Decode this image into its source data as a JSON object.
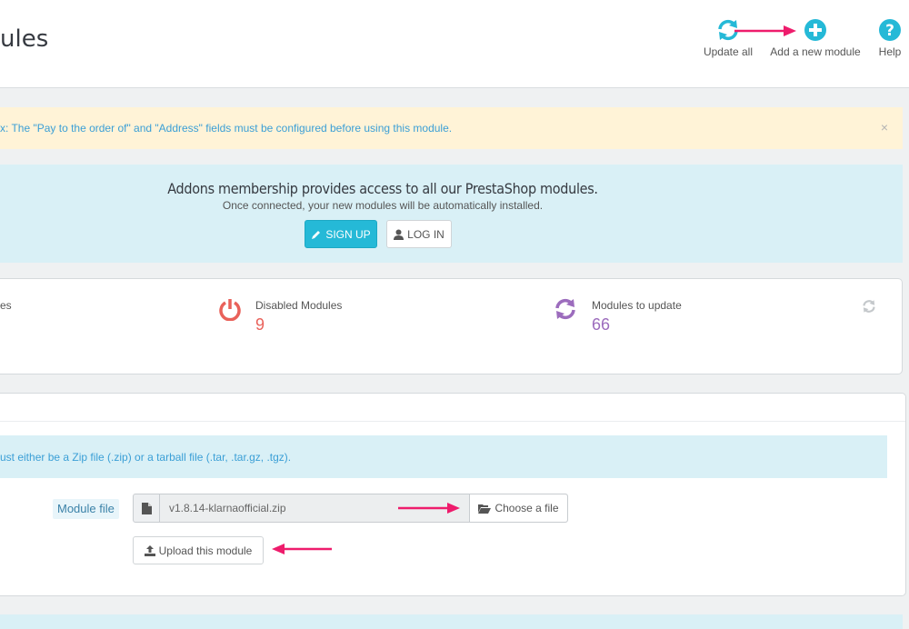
{
  "header": {
    "title": "ules",
    "toolbar": {
      "update_all": "Update all",
      "add_new_module": "Add a new module",
      "help": "Help"
    }
  },
  "warning": {
    "text": "x: The \"Pay to the order of\" and \"Address\" fields must be configured before using this module.",
    "close": "×"
  },
  "addons": {
    "title": "Addons membership provides access to all our PrestaShop modules.",
    "subtitle": "Once connected, your new modules will be automatically installed.",
    "signup": "SIGN UP",
    "login": "LOG IN"
  },
  "stats": {
    "first_label_fragment": "es",
    "disabled_label": "Disabled Modules",
    "disabled_value": "9",
    "update_label": "Modules to update",
    "update_value": "66"
  },
  "upload": {
    "info": "ust either be a Zip file (.zip) or a tarball file (.tar, .tar.gz, .tgz).",
    "file_label": "Module file",
    "file_value": "v1.8.14-klarnaofficial.zip",
    "choose": "Choose a file",
    "upload_button": "Upload this module"
  },
  "colors": {
    "accent": "#25b9d7",
    "warning_bg": "#fff3d7",
    "info_bg": "#d9f0f6",
    "disabled": "#e9615a",
    "update": "#9c6cbd",
    "arrow": "#ee1c6c"
  },
  "icons": [
    "refresh-icon",
    "plus-circle-icon",
    "help-icon",
    "power-icon",
    "file-icon",
    "folder-open-icon",
    "upload-icon",
    "pencil-icon",
    "user-icon",
    "close-icon"
  ]
}
